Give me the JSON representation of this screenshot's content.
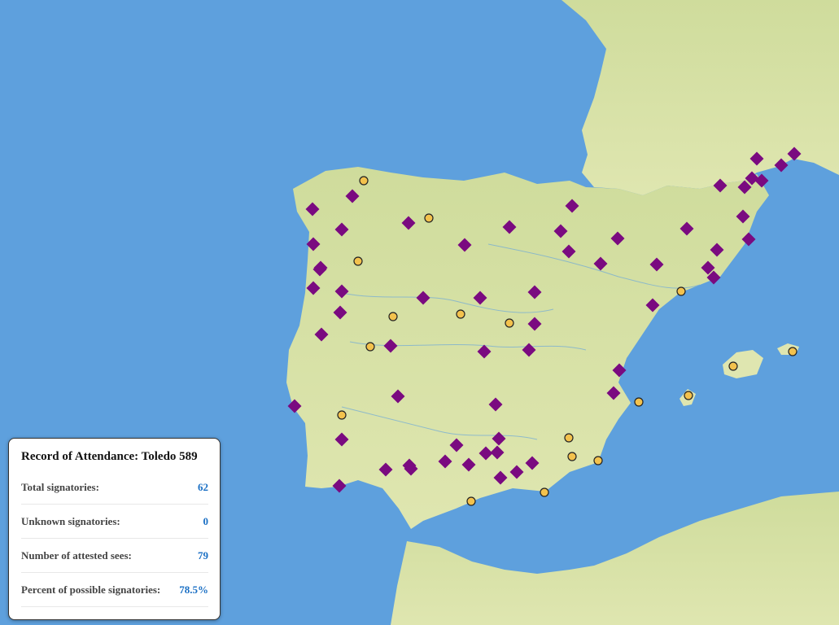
{
  "stats_panel": {
    "title": "Record of Attendance: Toledo 589",
    "rows": [
      {
        "label": "Total signatories:",
        "value": "62"
      },
      {
        "label": "Unknown signatories:",
        "value": "0"
      },
      {
        "label": "Number of attested sees:",
        "value": "79"
      },
      {
        "label": "Percent of possible signatories:",
        "value": "78.5%"
      }
    ]
  },
  "legend_colors": {
    "attested_see_marker": "#7a0a80",
    "other_see_marker": "#f3c24d",
    "sea": "#5ea0dd",
    "land": "#d4e0a0"
  },
  "markers": {
    "attested_icon": "purple-diamond-icon",
    "other_icon": "yellow-circle-icon"
  }
}
